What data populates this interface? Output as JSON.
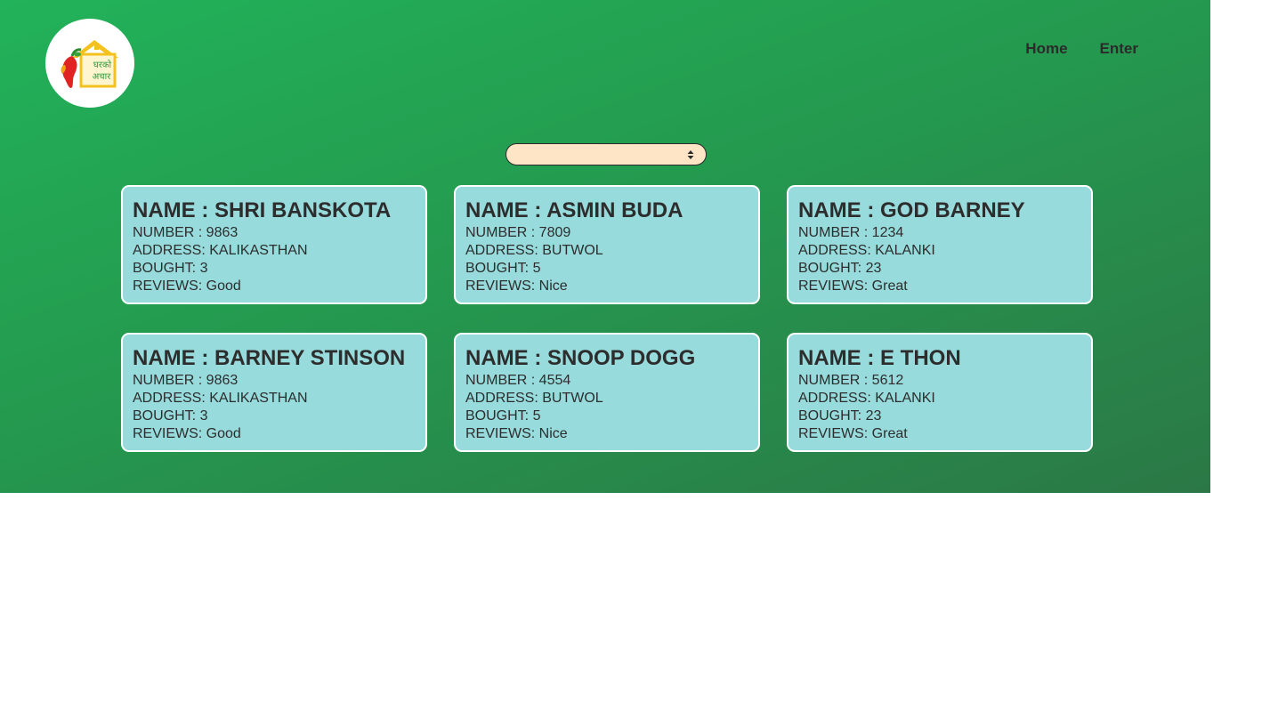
{
  "brand": {
    "logo_text_line1": "घरको",
    "logo_text_line2": "अचार",
    "logo_icon": "house-chilli-logo-icon"
  },
  "nav": {
    "home_label": "Home",
    "enter_label": "Enter"
  },
  "filter_select": {
    "value": "",
    "icon": "select-arrows-icon"
  },
  "colors": {
    "hero_gradient_start": "#22b259",
    "hero_gradient_end": "#2b7846",
    "card_bg": "#97dbdc",
    "select_bg": "#fde5c6",
    "text": "#2d2d2d"
  },
  "customers": [
    {
      "name": "NAME : SHRI BANSKOTA",
      "number": "NUMBER : 9863",
      "address": "ADDRESS: KALIKASTHAN",
      "bought": "BOUGHT: 3",
      "reviews": "REVIEWS: Good"
    },
    {
      "name": "NAME : ASMIN BUDA",
      "number": "NUMBER : 7809",
      "address": "ADDRESS: BUTWOL",
      "bought": "BOUGHT: 5",
      "reviews": "REVIEWS: Nice"
    },
    {
      "name": "NAME : GOD BARNEY",
      "number": "NUMBER : 1234",
      "address": "ADDRESS: KALANKI",
      "bought": "BOUGHT: 23",
      "reviews": "REVIEWS: Great"
    },
    {
      "name": "NAME : BARNEY STINSON",
      "number": "NUMBER : 9863",
      "address": "ADDRESS: KALIKASTHAN",
      "bought": "BOUGHT: 3",
      "reviews": "REVIEWS: Good"
    },
    {
      "name": "NAME : SNOOP DOGG",
      "number": "NUMBER : 4554",
      "address": "ADDRESS: BUTWOL",
      "bought": "BOUGHT: 5",
      "reviews": "REVIEWS: Nice"
    },
    {
      "name": "NAME : E THON",
      "number": "NUMBER : 5612",
      "address": "ADDRESS: KALANKI",
      "bought": "BOUGHT: 23",
      "reviews": "REVIEWS: Great"
    }
  ]
}
